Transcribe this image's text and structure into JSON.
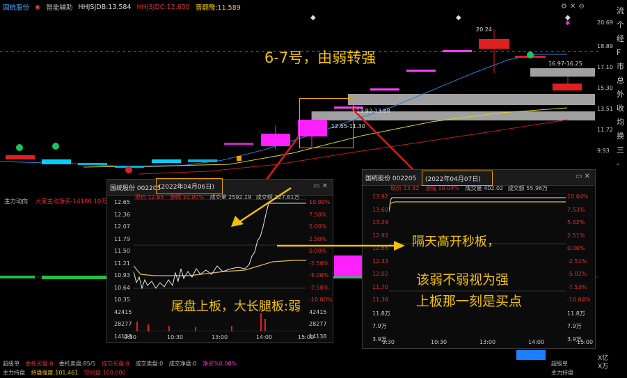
{
  "topbar": {
    "stock_name": "国统股份",
    "tool_label": "智能辅助",
    "ind1": "HHJSJDB:13.584",
    "ind2": "HHJSJDC:12.630",
    "ind3": "晋翻豫:11.589"
  },
  "right_axis": [
    "20.69",
    "18.89",
    "17.10",
    "15.30",
    "13.51",
    "11.72",
    "9.93"
  ],
  "right_edge_text": [
    "流",
    "个",
    "经",
    "F",
    "市",
    "总",
    "外",
    "收",
    "均",
    "换",
    "三",
    "-"
  ],
  "price_labels": {
    "high": "20.24",
    "range_1": "16.97-16.25",
    "range_2": "13.92-13.88",
    "range_3": "12.65-11.30"
  },
  "annotations": {
    "headline": "6-7号，由弱转强",
    "left_note": "尾盘上板，大长腿板:弱",
    "right_note": "隔天高开秒板，",
    "conclusion_1": "该弱不弱视为强",
    "conclusion_2": "上板那一刻是买点"
  },
  "volume_section": {
    "label": "主力动向",
    "series_text": "大家主动净买-14186.10万"
  },
  "left_popup": {
    "title": "国统股份 002205",
    "date": "(2022年04月06日)",
    "quote": "现价 12.65",
    "chg": "涨幅 10.00%",
    "vol": "成交量 2592.19",
    "amt": "成交额 327.81万",
    "y_left": [
      "12.65",
      "12.36",
      "12.07",
      "11.79",
      "11.50",
      "11.21",
      "10.93",
      "10.64",
      "10.35",
      "42415",
      "28277",
      "14138"
    ],
    "y_right": [
      "10.00%",
      "7.50%",
      "5.00%",
      "2.50%",
      "0.00%",
      "-2.50%",
      "-5.00%",
      "-7.50%",
      "-10.00%",
      "42415",
      "28277",
      "14138"
    ],
    "x": [
      "9:30",
      "10:30",
      "13:00",
      "14:00",
      "15:00"
    ]
  },
  "right_popup": {
    "title": "国统股份 002205",
    "date": "(2022年04月07日)",
    "quote": "现价 13.92",
    "chg": "涨幅 10.04%",
    "vol": "成交量 402.02",
    "amt": "成交额 55.96万",
    "y_left": [
      "13.92",
      "13.60",
      "13.29",
      "12.97",
      "12.65",
      "12.33",
      "12.02",
      "11.70",
      "11.38",
      "11.8万",
      "7.9万",
      "3.9万"
    ],
    "y_right": [
      "10.04%",
      "7.53%",
      "5.02%",
      "2.51%",
      "0.00%",
      "-2.51%",
      "-5.02%",
      "-7.53%",
      "-10.04%",
      "11.8万",
      "7.9万",
      "3.9万"
    ],
    "x": [
      "9:30",
      "10:30",
      "13:00",
      "14:00",
      "15:00"
    ],
    "unit_1": "X亿",
    "unit_2": "X万"
  },
  "footer": {
    "row1": [
      "超级单",
      "委托买盘:0",
      "委托卖盘:85/5",
      "成交买盘:0",
      "成交卖盘:0",
      "成交净盘:0",
      "净买%0.00%"
    ],
    "row2": [
      "主力持盘",
      "持盘强度:101.461",
      "空间盘:100.000"
    ],
    "right1": "超级单",
    "right2": "主力持盘"
  },
  "colors": {
    "up": "#e02020",
    "down": "#00c8ff",
    "annotation": "#f2c200",
    "highlight_box": "#f0a000",
    "arrow": "#e01818"
  }
}
